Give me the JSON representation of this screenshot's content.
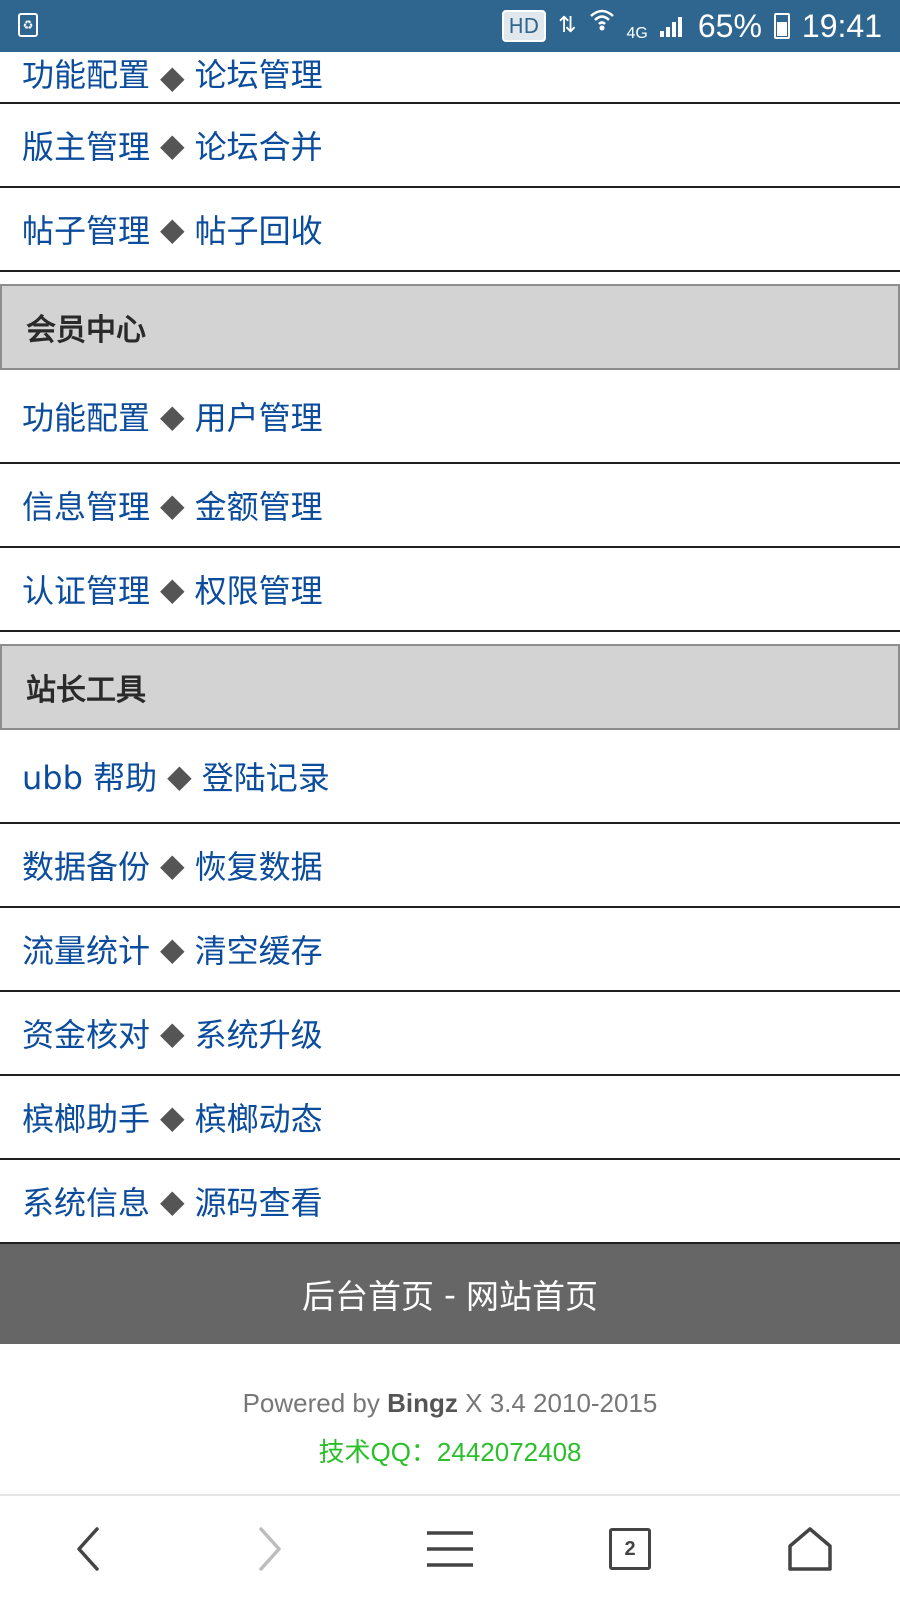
{
  "status_bar": {
    "hd_label": "HD",
    "network_label": "4G",
    "battery_percent": "65%",
    "time": "19:41"
  },
  "partial_row": {
    "left": "功能配置",
    "sep": "◆",
    "right": "论坛管理"
  },
  "forum_rows": [
    {
      "left": "版主管理",
      "sep": "◆",
      "right": "论坛合并"
    },
    {
      "left": "帖子管理",
      "sep": "◆",
      "right": "帖子回收"
    }
  ],
  "member_section": {
    "title": "会员中心",
    "rows": [
      {
        "left": "功能配置",
        "sep": "◆",
        "right": "用户管理"
      },
      {
        "left": "信息管理",
        "sep": "◆",
        "right": "金额管理"
      },
      {
        "left": "认证管理",
        "sep": "◆",
        "right": "权限管理"
      }
    ]
  },
  "tools_section": {
    "title": "站长工具",
    "rows": [
      {
        "left": "ubb 帮助",
        "sep": "◆",
        "right": "登陆记录"
      },
      {
        "left": "数据备份",
        "sep": "◆",
        "right": "恢复数据"
      },
      {
        "left": "流量统计",
        "sep": "◆",
        "right": "清空缓存"
      },
      {
        "left": "资金核对",
        "sep": "◆",
        "right": "系统升级"
      },
      {
        "left": "槟榔助手",
        "sep": "◆",
        "right": "槟榔动态"
      },
      {
        "left": "系统信息",
        "sep": "◆",
        "right": "源码查看"
      }
    ]
  },
  "footer": {
    "admin_home": "后台首页",
    "sep": "-",
    "site_home": "网站首页",
    "powered_prefix": "Powered by",
    "powered_brand": "Bingz",
    "powered_suffix": "X 3.4 2010-2015",
    "qq": "技术QQ：2442072408"
  },
  "browser_nav": {
    "tab_count": "2",
    "icons": [
      "back-icon",
      "forward-icon",
      "menu-icon",
      "tabs-icon",
      "home-icon"
    ]
  },
  "colors": {
    "status_bar": "#2f6690",
    "link": "#0b4c9c",
    "section_header_bg": "#d3d3d3",
    "footer_bar_bg": "#666666",
    "qq_text": "#2bbf2b"
  }
}
